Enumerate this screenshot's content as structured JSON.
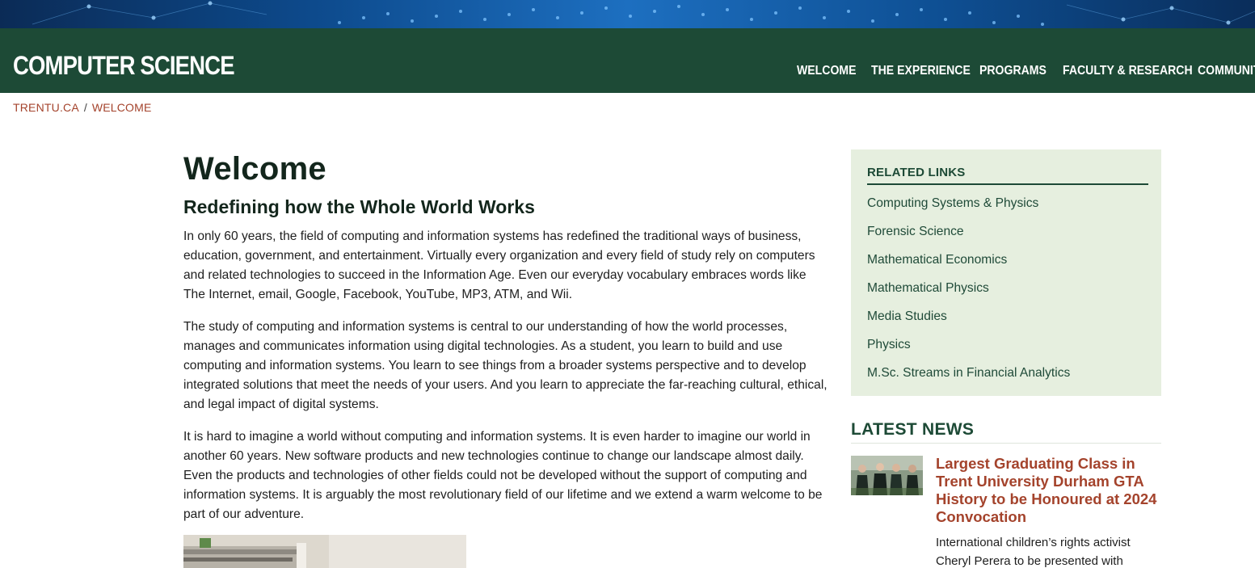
{
  "header": {
    "site_title": "COMPUTER SCIENCE",
    "nav": [
      "WELCOME",
      "THE EXPERIENCE",
      "PROGRAMS",
      "FACULTY & RESEARCH",
      "COMMUNITY"
    ]
  },
  "breadcrumb": {
    "items": [
      "TRENTU.CA",
      "WELCOME"
    ],
    "separator": "/"
  },
  "main": {
    "title": "Welcome",
    "subtitle": "Redefining how the Whole World Works",
    "paragraphs": [
      "In only 60 years, the field of computing and information systems has redefined the traditional ways of business, education, government, and entertainment.  Virtually every organization and every field of study rely on computers and related technologies to succeed in the Information Age.  Even our everyday vocabulary embraces words like The Internet, email, Google, Facebook, YouTube, MP3, ATM, and Wii.",
      "The study of computing and information systems is central to our understanding of how the world processes, manages and communicates information using digital technologies.  As a student, you learn to build and use computing and information systems.  You learn to see things from a broader systems perspective and to develop integrated solutions that meet the needs of your users.  And you learn to appreciate the far-reaching cultural, ethical, and legal impact of digital systems.",
      "It is hard to imagine a world without computing and information systems.  It is even harder to imagine our world in another 60 years.  New software products and new technologies continue to change our landscape almost daily.  Even the products and technologies of other fields could not be developed without the support of computing and information systems.  It is arguably the most revolutionary field of our lifetime and we extend a warm welcome to be part of our adventure."
    ]
  },
  "sidebar": {
    "related_heading": "RELATED LINKS",
    "related_links": [
      "Computing Systems & Physics",
      "Forensic Science",
      "Mathematical Economics",
      "Mathematical Physics",
      "Media Studies",
      "Physics",
      "M.Sc. Streams in Financial Analytics"
    ],
    "news_heading": "LATEST NEWS",
    "news": {
      "title": "Largest Graduating Class in Trent University Durham GTA History to be Honoured at 2024 Convocation",
      "excerpt": "International children’s rights activist Cheryl Perera to be presented with"
    }
  },
  "colors": {
    "header_green": "#1d4a36",
    "accent_rust": "#a4432c",
    "related_bg": "#e6efdf",
    "banner_blue": "#1d6fc0"
  }
}
